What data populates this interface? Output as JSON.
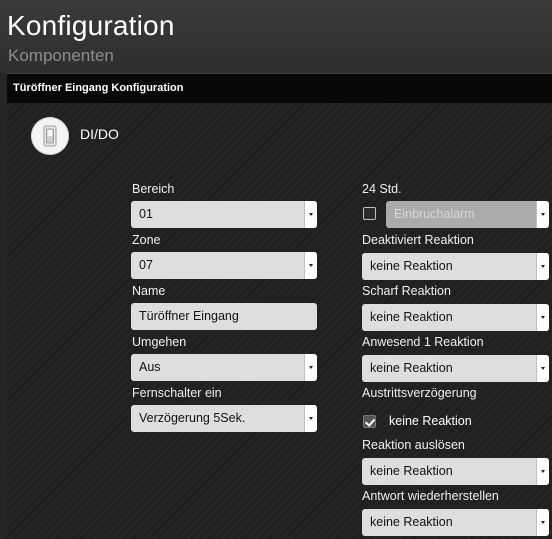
{
  "header": {
    "title": "Konfiguration",
    "subtitle": "Komponenten"
  },
  "panel": {
    "title": "Türöffner Eingang Konfiguration",
    "device_type": "DI/DO",
    "device_icon": "light-switch-icon"
  },
  "left_column": {
    "bereich": {
      "label": "Bereich",
      "value": "01"
    },
    "zone": {
      "label": "Zone",
      "value": "07"
    },
    "name": {
      "label": "Name",
      "value": "Türöffner Eingang"
    },
    "umgehen": {
      "label": "Umgehen",
      "value": "Aus"
    },
    "fernschalter": {
      "label": "Fernschalter ein",
      "value": "Verzögerung 5Sek."
    }
  },
  "right_column": {
    "std24": {
      "label": "24 Std.",
      "checked": false,
      "value": "Einbruchalarm"
    },
    "deaktiviert": {
      "label": "Deaktiviert Reaktion",
      "value": "keine Reaktion"
    },
    "scharf": {
      "label": "Scharf Reaktion",
      "value": "keine Reaktion"
    },
    "anwesend": {
      "label": "Anwesend 1 Reaktion",
      "value": "keine Reaktion"
    },
    "austritt": {
      "label": "Austrittsverzögerung",
      "checked": true,
      "value": "keine Reaktion"
    },
    "ausloesen": {
      "label": "Reaktion auslösen",
      "value": "keine Reaktion"
    },
    "wiederherstellen": {
      "label": "Antwort wiederherstellen",
      "value": "keine Reaktion"
    }
  },
  "colors": {
    "background": "#252525",
    "panel_header": "#070707",
    "field": "#dedede",
    "field_disabled": "#ababab"
  }
}
